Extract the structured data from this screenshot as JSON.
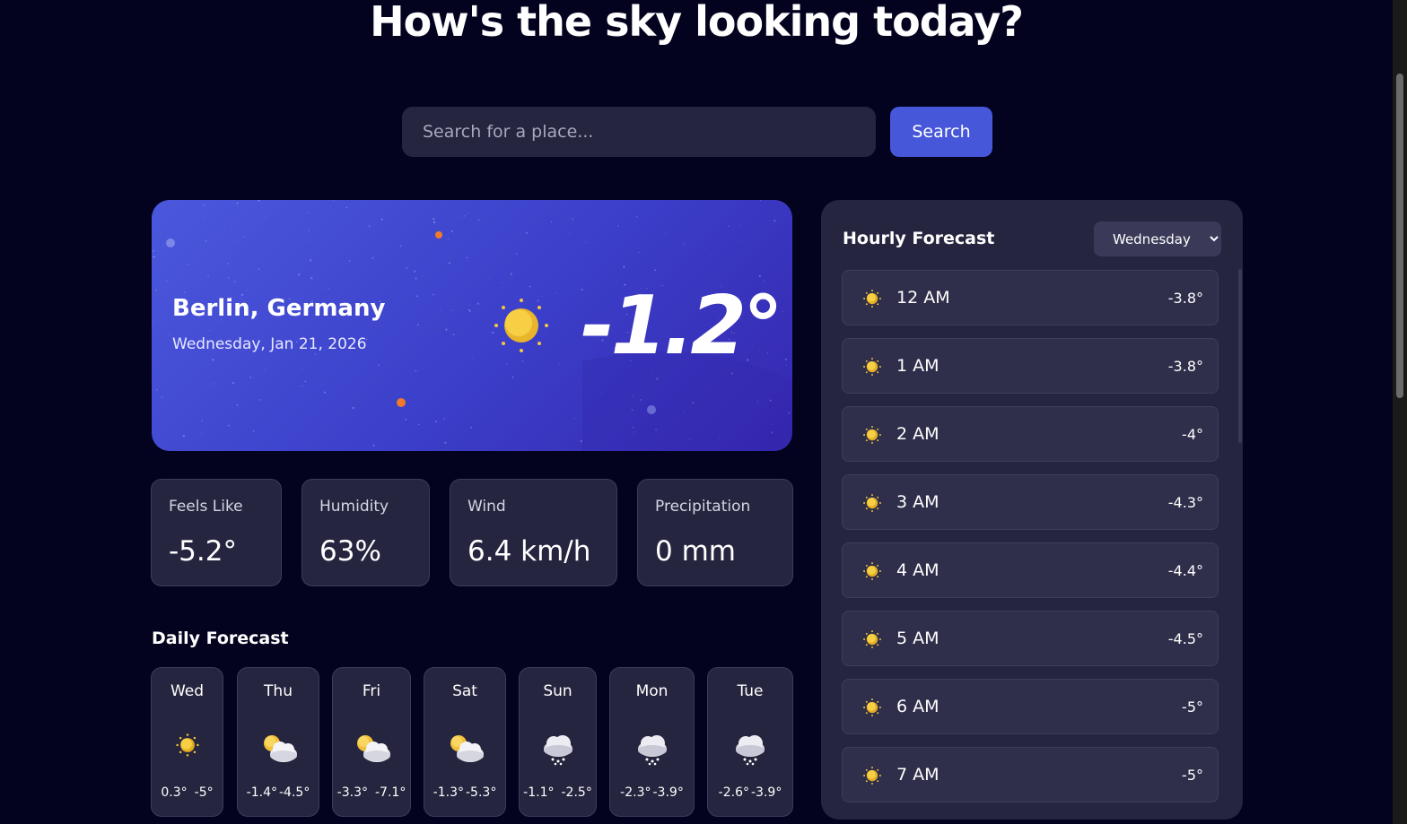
{
  "header": {
    "title": "How's the sky looking today?"
  },
  "search": {
    "placeholder": "Search for a place...",
    "button_label": "Search"
  },
  "current": {
    "location": "Berlin, Germany",
    "date": "Wednesday, Jan 21, 2026",
    "temperature": "-1.2°",
    "icon": "sun-icon"
  },
  "stats": [
    {
      "label": "Feels Like",
      "value": "-5.2°"
    },
    {
      "label": "Humidity",
      "value": "63%"
    },
    {
      "label": "Wind",
      "value": "6.4 km/h"
    },
    {
      "label": "Precipitation",
      "value": "0 mm"
    }
  ],
  "daily": {
    "title": "Daily Forecast",
    "days": [
      {
        "day": "Wed",
        "icon": "sun-icon",
        "high": "0.3°",
        "low": "-5°"
      },
      {
        "day": "Thu",
        "icon": "partly-cloudy-icon",
        "high": "-1.4°",
        "low": "-4.5°"
      },
      {
        "day": "Fri",
        "icon": "partly-cloudy-icon",
        "high": "-3.3°",
        "low": "-7.1°"
      },
      {
        "day": "Sat",
        "icon": "partly-cloudy-icon",
        "high": "-1.3°",
        "low": "-5.3°"
      },
      {
        "day": "Sun",
        "icon": "snow-cloud-icon",
        "high": "-1.1°",
        "low": "-2.5°"
      },
      {
        "day": "Mon",
        "icon": "snow-cloud-icon",
        "high": "-2.3°",
        "low": "-3.9°"
      },
      {
        "day": "Tue",
        "icon": "snow-cloud-icon",
        "high": "-2.6°",
        "low": "-3.9°"
      }
    ]
  },
  "hourly": {
    "title": "Hourly Forecast",
    "selected_day": "Wednesday",
    "hours": [
      {
        "time": "12 AM",
        "icon": "sun-icon",
        "temp": "-3.8°"
      },
      {
        "time": "1 AM",
        "icon": "sun-icon",
        "temp": "-3.8°"
      },
      {
        "time": "2 AM",
        "icon": "sun-icon",
        "temp": "-4°"
      },
      {
        "time": "3 AM",
        "icon": "sun-icon",
        "temp": "-4.3°"
      },
      {
        "time": "4 AM",
        "icon": "sun-icon",
        "temp": "-4.4°"
      },
      {
        "time": "5 AM",
        "icon": "sun-icon",
        "temp": "-4.5°"
      },
      {
        "time": "6 AM",
        "icon": "sun-icon",
        "temp": "-5°"
      },
      {
        "time": "7 AM",
        "icon": "sun-icon",
        "temp": "-5°"
      }
    ]
  },
  "colors": {
    "background": "#03031f",
    "card": "#25253f",
    "accent": "#4657d9",
    "hero_start": "#4b58dc",
    "hero_end": "#3627b0"
  }
}
